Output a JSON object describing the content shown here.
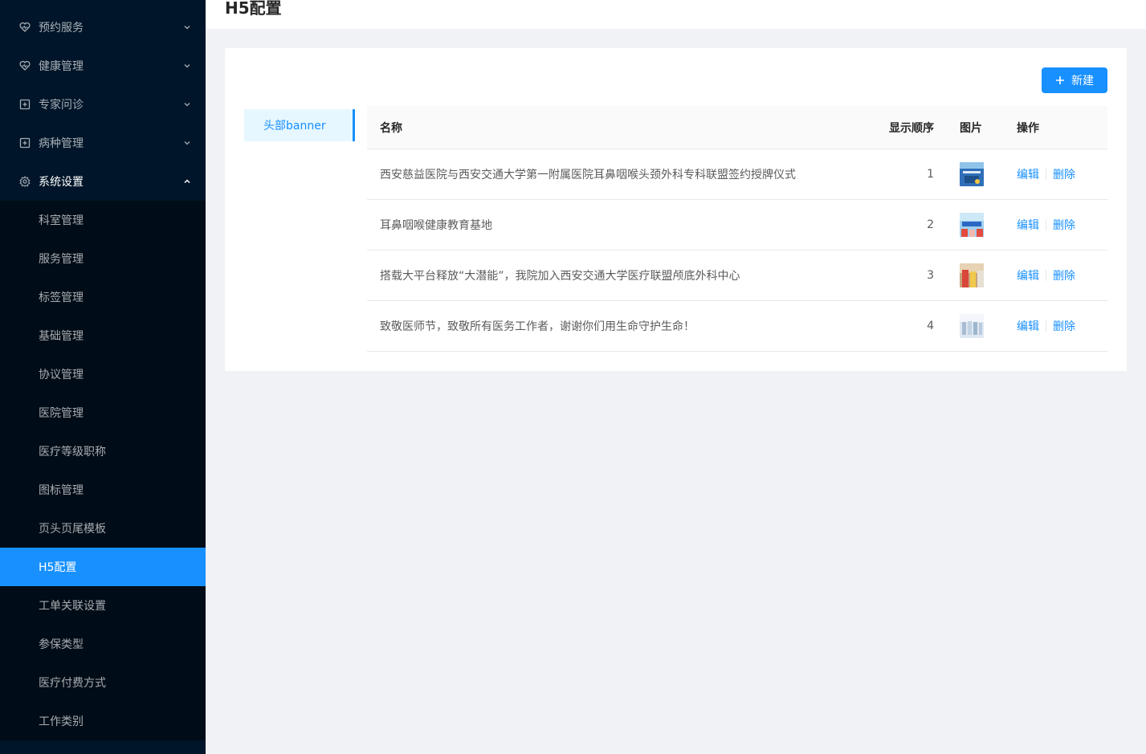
{
  "sidebar": {
    "menus": [
      {
        "label": "预约服务",
        "icon": "heart-icon"
      },
      {
        "label": "健康管理",
        "icon": "heart-pulse-icon"
      },
      {
        "label": "专家问诊",
        "icon": "medical-box-icon"
      },
      {
        "label": "病种管理",
        "icon": "medical-box-icon"
      },
      {
        "label": "系统设置",
        "icon": "gear-icon"
      }
    ],
    "sub_items": [
      {
        "label": "科室管理"
      },
      {
        "label": "服务管理"
      },
      {
        "label": "标签管理"
      },
      {
        "label": "基础管理"
      },
      {
        "label": "协议管理"
      },
      {
        "label": "医院管理"
      },
      {
        "label": "医疗等级职称"
      },
      {
        "label": "图标管理"
      },
      {
        "label": "页头页尾模板"
      },
      {
        "label": "H5配置"
      },
      {
        "label": "工单关联设置"
      },
      {
        "label": "参保类型"
      },
      {
        "label": "医疗付费方式"
      },
      {
        "label": "工作类别"
      }
    ],
    "active_sub": "H5配置"
  },
  "header": {
    "title": "H5配置"
  },
  "toolbar": {
    "new_label": "新建"
  },
  "left_tabs": [
    {
      "label": "头部banner"
    }
  ],
  "table": {
    "columns": [
      "名称",
      "显示顺序",
      "图片",
      "操作"
    ],
    "rows": [
      {
        "name": "西安慈益医院与西安交通大学第一附属医院耳鼻咽喉头颈外科专科联盟签约授牌仪式",
        "order": "1",
        "edit": "编辑",
        "delete": "删除"
      },
      {
        "name": "耳鼻咽喉健康教育基地",
        "order": "2",
        "edit": "编辑",
        "delete": "删除"
      },
      {
        "name": "搭载大平台释放“大潜能”，我院加入西安交通大学医疗联盟颅底外科中心",
        "order": "3",
        "edit": "编辑",
        "delete": "删除"
      },
      {
        "name": "致敬医师节，致敬所有医务工作者，谢谢你们用生命守护生命！",
        "order": "4",
        "edit": "编辑",
        "delete": "删除"
      }
    ]
  },
  "colors": {
    "sidebar_bg": "#001529",
    "submenu_bg": "#000c17",
    "accent": "#1890ff",
    "page_bg": "#f0f2f5"
  }
}
